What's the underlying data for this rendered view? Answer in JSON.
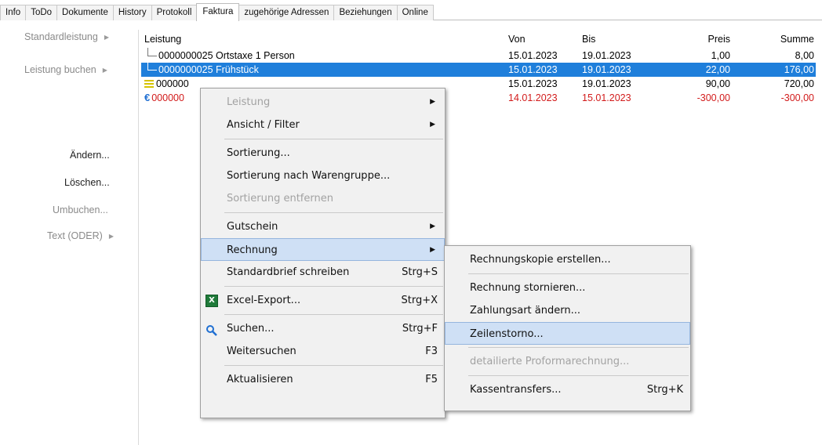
{
  "tabs": [
    {
      "label": "Info"
    },
    {
      "label": "ToDo"
    },
    {
      "label": "Dokumente"
    },
    {
      "label": "History"
    },
    {
      "label": "Protokoll"
    },
    {
      "label": "Faktura"
    },
    {
      "label": "zugehörige Adressen"
    },
    {
      "label": "Beziehungen"
    },
    {
      "label": "Online"
    }
  ],
  "left_panel": {
    "standardleistung": "Standardleistung",
    "leistung_buchen": "Leistung buchen",
    "aendern": "Ändern...",
    "loeschen": "Löschen...",
    "umbuchen": "Umbuchen...",
    "text_oder": "Text (ODER)",
    "arrow": "▶"
  },
  "grid": {
    "headers": {
      "leistung": "Leistung",
      "von": "Von",
      "bis": "Bis",
      "preis": "Preis",
      "summe": "Summe"
    },
    "rows": [
      {
        "name": "0000000025  Ortstaxe 1 Person",
        "von": "15.01.2023",
        "bis": "19.01.2023",
        "preis": "1,00",
        "summe": "8,00"
      },
      {
        "name": "0000000025  Frühstück",
        "von": "15.01.2023",
        "bis": "19.01.2023",
        "preis": "22,00",
        "summe": "176,00"
      },
      {
        "name": "000000",
        "von": "15.01.2023",
        "bis": "19.01.2023",
        "preis": "90,00",
        "summe": "720,00"
      },
      {
        "name": "000000",
        "von": "14.01.2023",
        "bis": "15.01.2023",
        "preis": "-300,00",
        "summe": "-300,00"
      }
    ],
    "euro_glyph": "€"
  },
  "context_menu": {
    "leistung": "Leistung",
    "ansicht_filter": "Ansicht / Filter",
    "sortierung": "Sortierung...",
    "sortierung_warengruppe": "Sortierung nach Warengruppe...",
    "sortierung_entfernen": "Sortierung entfernen",
    "gutschein": "Gutschein",
    "rechnung": "Rechnung",
    "standardbrief": "Standardbrief schreiben",
    "standardbrief_sc": "Strg+S",
    "excel_export": "Excel-Export...",
    "excel_export_sc": "Strg+X",
    "suchen": "Suchen...",
    "suchen_sc": "Strg+F",
    "weitersuchen": "Weitersuchen",
    "weitersuchen_sc": "F3",
    "aktualisieren": "Aktualisieren",
    "aktualisieren_sc": "F5",
    "arrow": "▶"
  },
  "submenu": {
    "rechnungskopie": "Rechnungskopie erstellen...",
    "stornieren": "Rechnung stornieren...",
    "zahlungsart": "Zahlungsart ändern...",
    "zeilenstorno": "Zeilenstorno...",
    "proforma": "detailierte Proformarechnung...",
    "kassentransfers": "Kassentransfers...",
    "kassentransfers_sc": "Strg+K"
  },
  "colors": {
    "selection": "#1f7fdb",
    "negative": "#d21b1b",
    "menu_highlight": "#cfe0f5"
  }
}
